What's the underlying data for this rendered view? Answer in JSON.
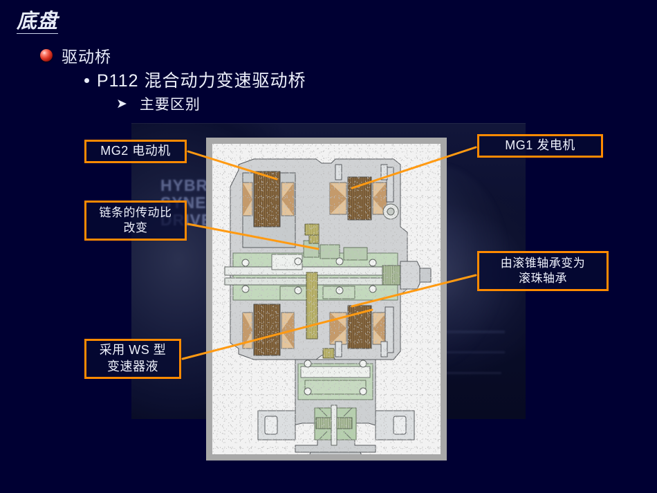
{
  "slide": {
    "title": "底盘",
    "background_color": "#000033",
    "accent_color": "#ff8a00",
    "text_color": "#eef1fb"
  },
  "outline": {
    "level1": {
      "bullet_icon": "red-sphere-bullet-icon",
      "text": "驱动桥"
    },
    "level2": {
      "bullet_icon": "round-dot-bullet-icon",
      "text": "P112  混合动力变速驱动桥"
    },
    "level3": {
      "bullet_icon": "arrowhead-bullet-icon",
      "bullet_glyph": "➤",
      "text": "主要区别"
    }
  },
  "figure": {
    "caption_background": "HYBRID\nSYNERGY\nDRIVE",
    "description": "混合动力变速驱动桥剖视图"
  },
  "callouts": [
    {
      "id": "mg2",
      "text": "MG2  电动机",
      "side": "left"
    },
    {
      "id": "chain",
      "text": "链条的传动比\n改变",
      "side": "left"
    },
    {
      "id": "ws",
      "text": "采用 WS 型\n变速器液",
      "side": "left"
    },
    {
      "id": "mg1",
      "text": "MG1  发电机",
      "side": "right"
    },
    {
      "id": "bear",
      "text": "由滚锥轴承变为\n滚珠轴承",
      "side": "right"
    }
  ]
}
